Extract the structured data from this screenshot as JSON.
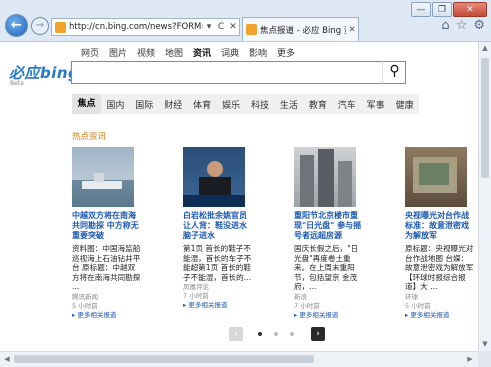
{
  "browser": {
    "url": "http://cn.bing.com/news?FORM=Z9LH",
    "tab_title": "焦点报道 - 必应 Bing 资讯",
    "address_controls": [
      "▾",
      "C",
      "✕"
    ],
    "window_controls": [
      "—",
      "❐",
      "✕"
    ]
  },
  "topnav": [
    "网页",
    "图片",
    "视频",
    "地图",
    "资讯",
    "词典",
    "影响力",
    "更多"
  ],
  "topnav_active": "资讯",
  "logo": {
    "text": "必应bing",
    "sub": "Beta"
  },
  "search": {
    "value": "",
    "placeholder": ""
  },
  "categories": [
    "焦点",
    "国内",
    "国际",
    "财经",
    "体育",
    "娱乐",
    "科技",
    "生活",
    "教育",
    "汽车",
    "军事",
    "健康"
  ],
  "categories_active": "焦点",
  "section_title": "热点资讯",
  "cards": [
    {
      "headline": "中越双方将在南海共同勘探 中方称无重要突破",
      "body": "资料图：中国海监船巡视海上石油钻井平台 原标题：中越双方将在南海共同勘探 ...",
      "source": "腾讯新闻",
      "time": "5 小时前",
      "more": "▸ 更多相关报道"
    },
    {
      "headline": "白岩松批余姚官员让人背：鞋没进水脑子进水",
      "body": "第1页 首长的鞋子不能湿，首长的车子不能超第1页 首长的鞋子不能湿，首长的...",
      "source": "凤凰评论",
      "time": "7 小时前",
      "more": "▸ 更多相关报道"
    },
    {
      "headline": "重阳节北京楼市重现\"日光盘\" 参与摇号者远超房源",
      "body": "国庆长假之后，\"日光盘\"再度卷土重来。在上周末重阳节，包括望京 金茂府，...",
      "source": "新浪",
      "time": "7 小时前",
      "more": "▸ 更多相关报道"
    },
    {
      "headline": "央视曝光对台作战标准：故意泄密戏为解放军",
      "body": "原标题：央视曝光对台作战地图 台媒：故意泄密戏为解放军【环球时报综合报道】大 ...",
      "source": "环球",
      "time": "5 小时前",
      "more": "▸ 更多相关报道"
    }
  ],
  "pager": {
    "prev": "‹",
    "next": "›",
    "count": 3,
    "active": 0
  },
  "colors": {
    "link": "#1a58b2",
    "hot": "#d37a06",
    "accent": "#2678c5"
  }
}
